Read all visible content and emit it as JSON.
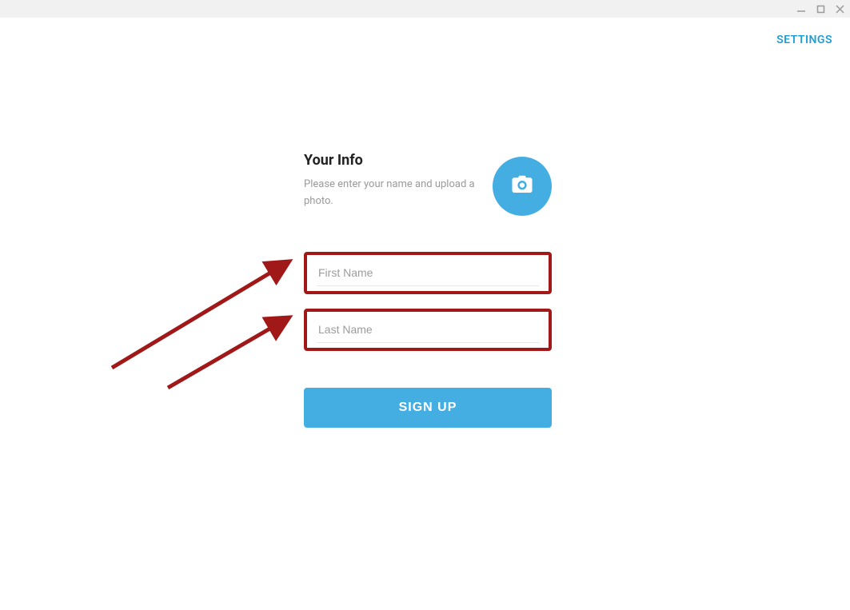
{
  "window": {
    "minimize": "—",
    "maximize": "▢",
    "close": "✕"
  },
  "settings_label": "SETTINGS",
  "form": {
    "title": "Your Info",
    "subtitle": "Please enter your name and upload a photo.",
    "first_name_placeholder": "First Name",
    "last_name_placeholder": "Last Name",
    "signup_label": "SIGN UP"
  },
  "annotations": {
    "arrow1_target": "first-name-field",
    "arrow2_target": "last-name-field"
  }
}
